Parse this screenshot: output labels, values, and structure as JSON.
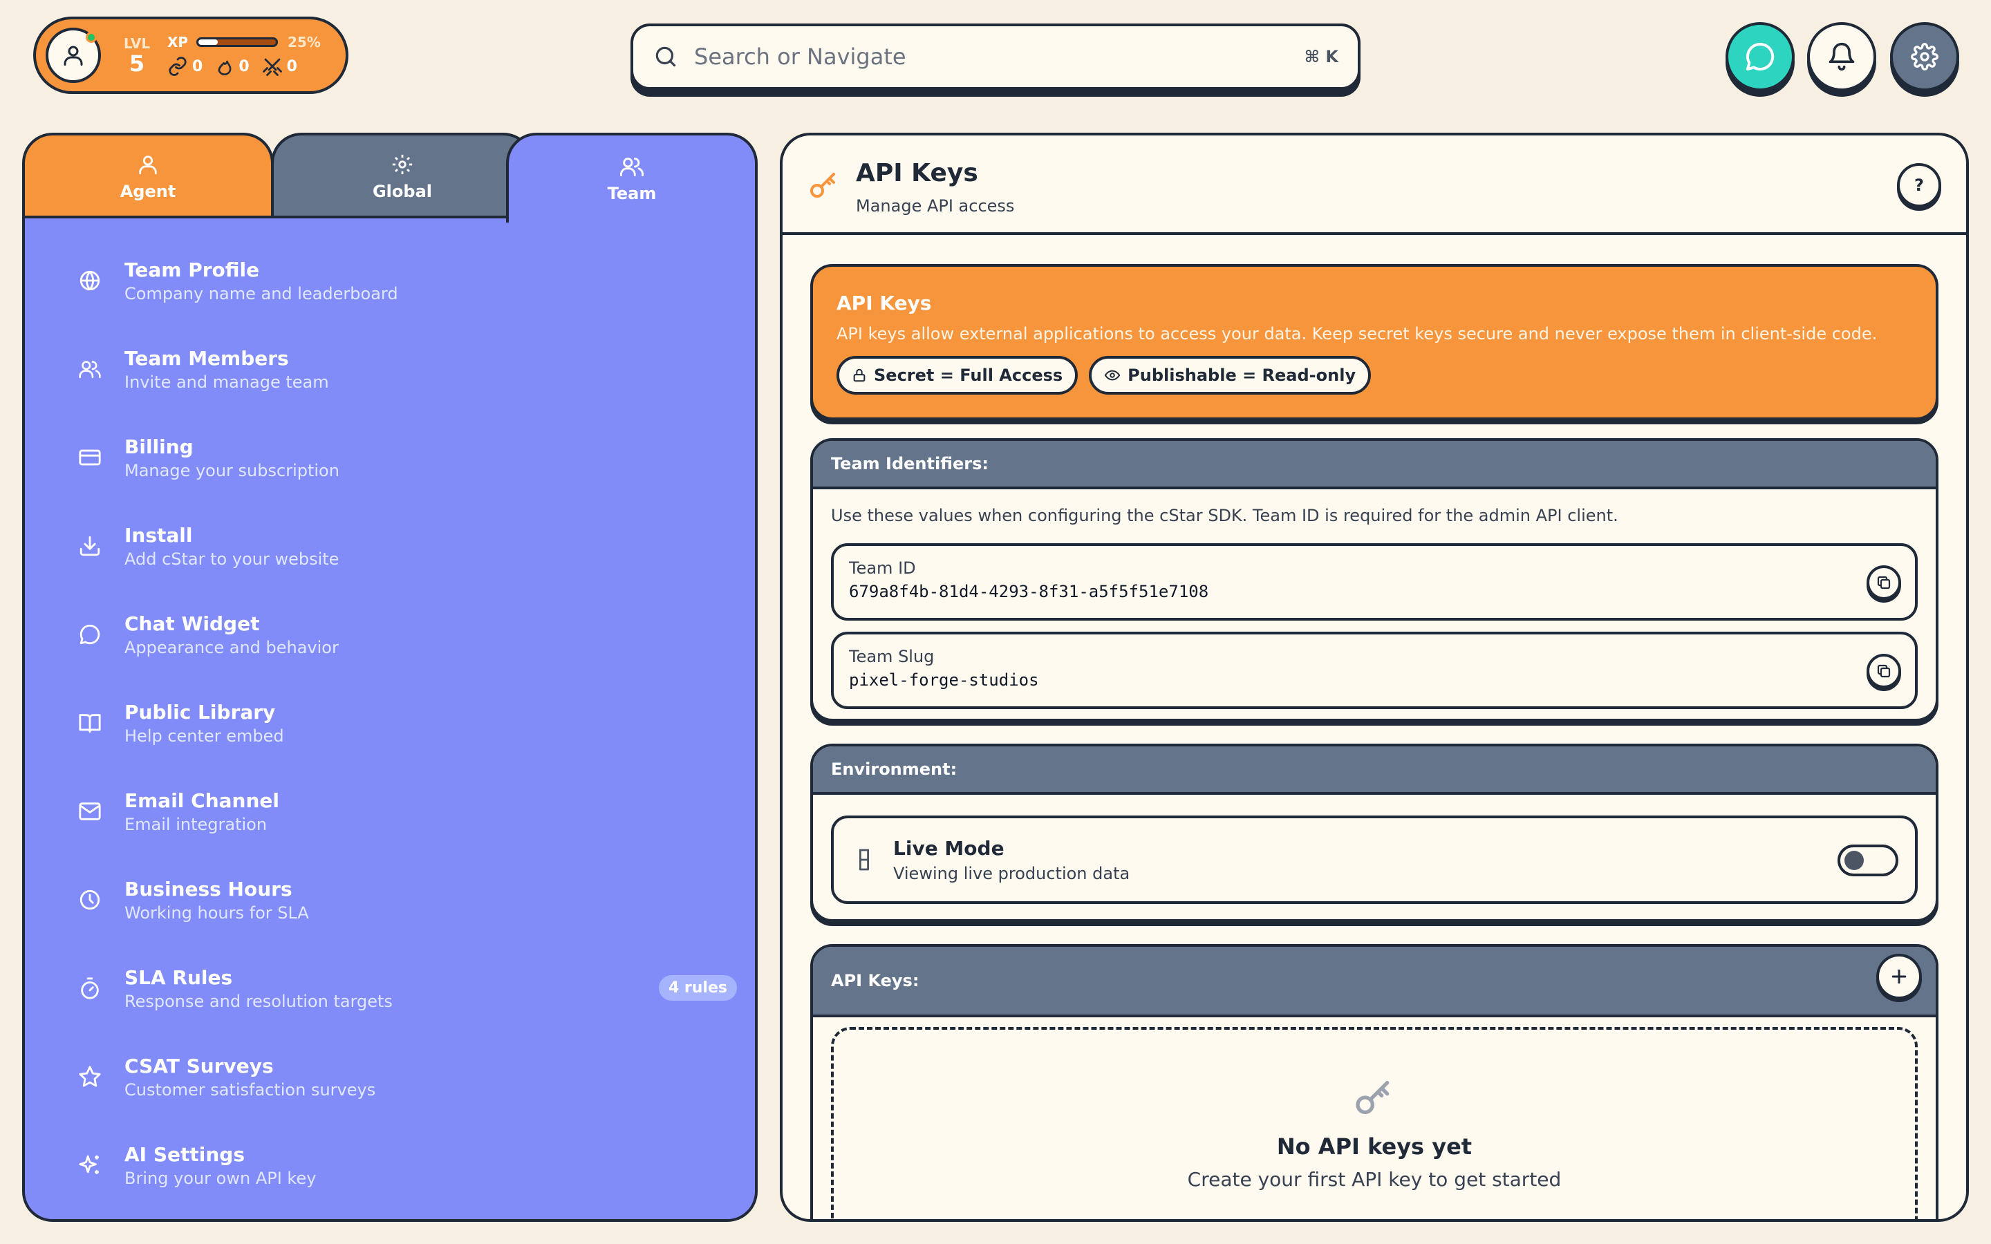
{
  "player": {
    "lvl_label": "LVL",
    "lvl_value": "5",
    "xp_label": "XP",
    "xp_percent_text": "25%",
    "xp_fraction": 0.25,
    "stats": [
      {
        "icon": "link-icon",
        "value": "0"
      },
      {
        "icon": "flame-icon",
        "value": "0"
      },
      {
        "icon": "swords-icon",
        "value": "0"
      }
    ]
  },
  "search": {
    "placeholder": "Search or Navigate",
    "shortcut": "⌘ K"
  },
  "topbar": {
    "chat_color": "#2dd4bf",
    "settings_color": "#64748b"
  },
  "tabs": [
    {
      "label": "Agent",
      "icon": "user-icon"
    },
    {
      "label": "Global",
      "icon": "gear-icon"
    },
    {
      "label": "Team",
      "icon": "users-icon"
    }
  ],
  "sidebar": {
    "items": [
      {
        "title": "Team Profile",
        "subtitle": "Company name and leaderboard",
        "icon": "globe-icon"
      },
      {
        "title": "Team Members",
        "subtitle": "Invite and manage team",
        "icon": "users-icon"
      },
      {
        "title": "Billing",
        "subtitle": "Manage your subscription",
        "icon": "credit-card-icon"
      },
      {
        "title": "Install",
        "subtitle": "Add cStar to your website",
        "icon": "download-icon"
      },
      {
        "title": "Chat Widget",
        "subtitle": "Appearance and behavior",
        "icon": "chat-bubble-icon"
      },
      {
        "title": "Public Library",
        "subtitle": "Help center embed",
        "icon": "book-icon"
      },
      {
        "title": "Email Channel",
        "subtitle": "Email integration",
        "icon": "mail-icon"
      },
      {
        "title": "Business Hours",
        "subtitle": "Working hours for SLA",
        "icon": "clock-icon"
      },
      {
        "title": "SLA Rules",
        "subtitle": "Response and resolution targets",
        "icon": "timer-icon",
        "badge": "4 rules"
      },
      {
        "title": "CSAT Surveys",
        "subtitle": "Customer satisfaction surveys",
        "icon": "star-icon"
      },
      {
        "title": "AI Settings",
        "subtitle": "Bring your own API key",
        "icon": "sparkles-icon"
      }
    ]
  },
  "main": {
    "title": "API Keys",
    "subtitle": "Manage API access",
    "help_label": "?",
    "info": {
      "title": "API Keys",
      "text": "API keys allow external applications to access your data. Keep secret keys secure and never expose them in client-side code.",
      "pill_secret": "Secret = Full Access",
      "pill_publishable": "Publishable = Read-only"
    },
    "identifiers": {
      "heading": "Team Identifiers:",
      "description": "Use these values when configuring the cStar SDK. Team ID is required for the admin API client.",
      "team_id_label": "Team ID",
      "team_id_value": "679a8f4b-81d4-4293-8f31-a5f5f51e7108",
      "team_slug_label": "Team Slug",
      "team_slug_value": "pixel-forge-studios"
    },
    "environment": {
      "heading": "Environment:",
      "mode_title": "Live Mode",
      "mode_subtitle": "Viewing live production data",
      "toggle_on": false
    },
    "api_keys": {
      "heading": "API Keys:",
      "empty_title": "No API keys yet",
      "empty_subtitle": "Create your first API key to get started"
    }
  }
}
